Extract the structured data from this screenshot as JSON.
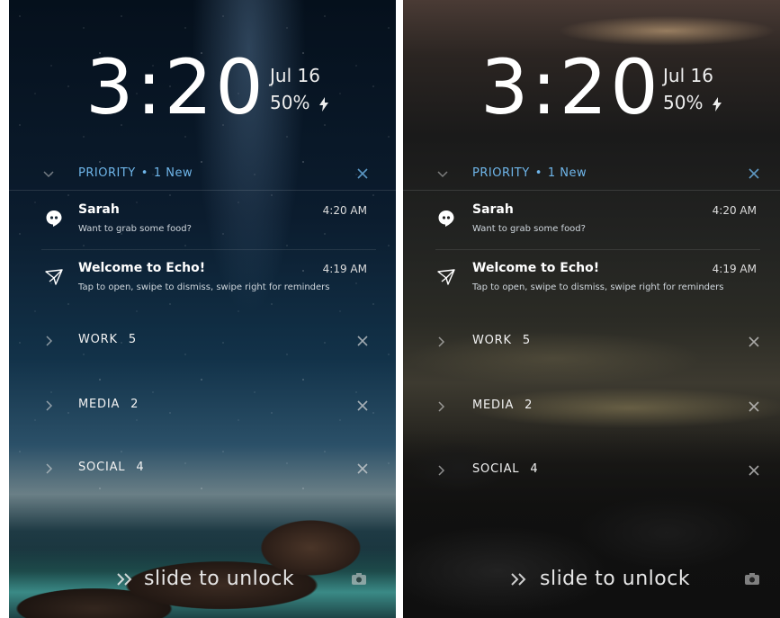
{
  "screens": [
    {
      "id": "left",
      "time": "3:20",
      "date": "Jul 16",
      "battery": "50%",
      "priority": {
        "label": "PRIORITY",
        "new_count": "1 New"
      },
      "notifications": [
        {
          "app_icon": "hangouts-icon",
          "title": "Sarah",
          "time": "4:20 AM",
          "body": "Want to grab some food?"
        },
        {
          "app_icon": "echo-bird-icon",
          "title": "Welcome to Echo!",
          "time": "4:19 AM",
          "body": "Tap to open, swipe to dismiss, swipe right for reminders"
        }
      ],
      "categories": [
        {
          "label": "WORK",
          "count": "5"
        },
        {
          "label": "MEDIA",
          "count": "2"
        },
        {
          "label": "SOCIAL",
          "count": "4"
        }
      ],
      "unlock_text": "slide to unlock"
    },
    {
      "id": "right",
      "time": "3:20",
      "date": "Jul 16",
      "battery": "50%",
      "priority": {
        "label": "PRIORITY",
        "new_count": "1 New"
      },
      "notifications": [
        {
          "app_icon": "hangouts-icon",
          "title": "Sarah",
          "time": "4:20 AM",
          "body": "Want to grab some food?"
        },
        {
          "app_icon": "echo-bird-icon",
          "title": "Welcome to Echo!",
          "time": "4:19 AM",
          "body": "Tap to open, swipe to dismiss, swipe right for reminders"
        }
      ],
      "categories": [
        {
          "label": "WORK",
          "count": "5"
        },
        {
          "label": "MEDIA",
          "count": "2"
        },
        {
          "label": "SOCIAL",
          "count": "4"
        }
      ],
      "unlock_text": "slide to unlock"
    }
  ],
  "colors": {
    "priority_accent": "#6fb6ea",
    "text_primary": "#ffffff",
    "text_secondary": "#cfd6dc"
  },
  "icons": {
    "battery_charging": "bolt-icon",
    "expand": "chevron-down-icon",
    "category_expand": "chevron-right-icon",
    "dismiss": "close-icon",
    "unlock": "double-chevron-right-icon",
    "camera": "camera-icon"
  }
}
